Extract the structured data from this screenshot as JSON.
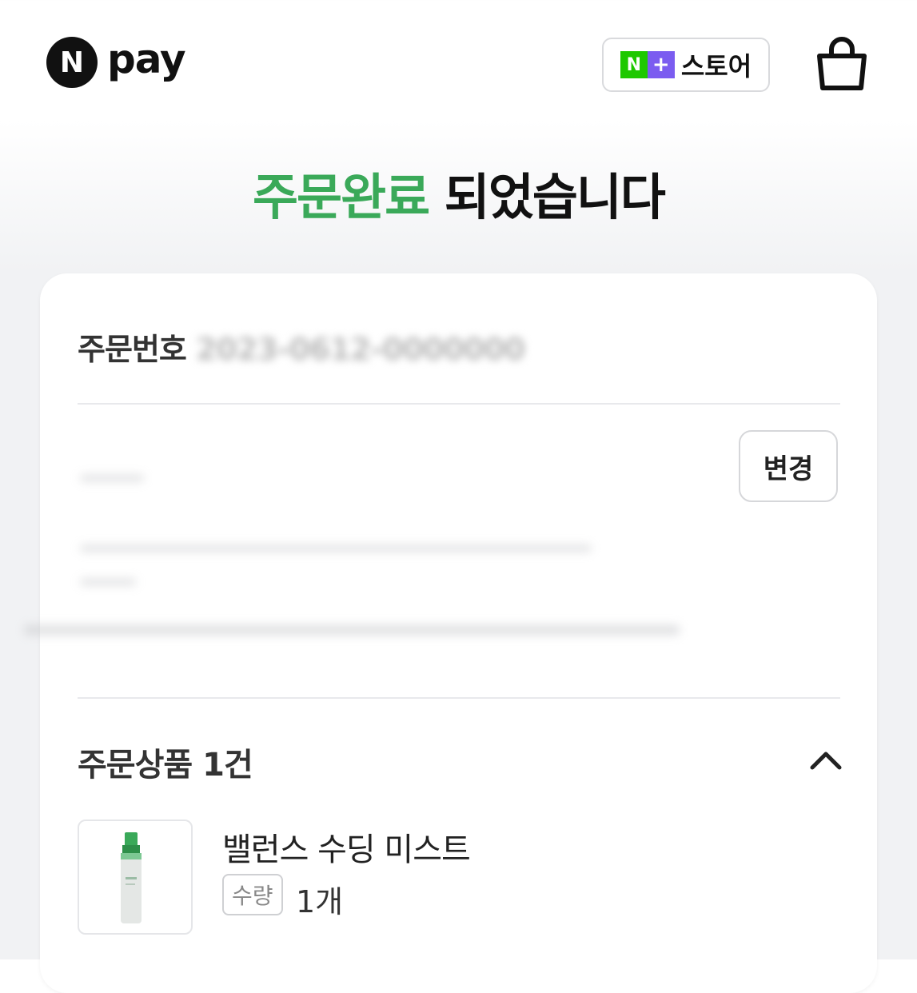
{
  "header": {
    "logo_letter": "N",
    "logo_word": "pay",
    "store_badge_n": "N",
    "store_badge_plus": "+",
    "store_label": "스토어",
    "cart_icon": "shopping-bag-icon"
  },
  "title": {
    "highlight": "주문완료",
    "rest": " 되었습니다",
    "highlight_color": "#3aa959"
  },
  "order": {
    "number_label": "주문번호 ",
    "number_value": "2023-0612-0000000"
  },
  "address": {
    "change_label": "변경"
  },
  "items": {
    "title": "주문상품 1건",
    "toggle_icon": "chevron-up-icon",
    "products": [
      {
        "name": "밸런스 수딩 미스트",
        "qty_label": "수량",
        "qty_value": "1개",
        "image_icon": "mist-bottle-icon"
      }
    ]
  }
}
